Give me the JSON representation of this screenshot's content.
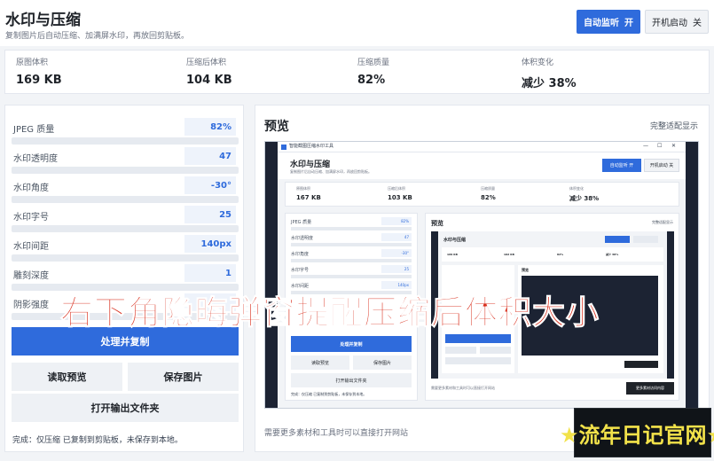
{
  "header": {
    "title": "水印与压缩",
    "subtitle": "复制图片后自动压缩、加满屏水印，再放回剪贴板。",
    "monitor_label": "自动监听",
    "monitor_state": "开",
    "startup_label": "开机启动",
    "startup_state": "关"
  },
  "stats": [
    {
      "label": "原图体积",
      "value": "169 KB"
    },
    {
      "label": "压缩后体积",
      "value": "104 KB"
    },
    {
      "label": "压缩质量",
      "value": "82%"
    },
    {
      "label": "体积变化",
      "value": "减少 38%"
    }
  ],
  "params": [
    {
      "label": "JPEG 质量",
      "value": "82%"
    },
    {
      "label": "水印透明度",
      "value": "47"
    },
    {
      "label": "水印角度",
      "value": "-30°"
    },
    {
      "label": "水印字号",
      "value": "25"
    },
    {
      "label": "水印间距",
      "value": "140px"
    },
    {
      "label": "雕刻深度",
      "value": "1"
    },
    {
      "label": "阴影强度",
      "value": ""
    }
  ],
  "actions": {
    "process": "处理并复制",
    "read_preview": "读取预览",
    "save_image": "保存图片",
    "open_folder": "打开输出文件夹"
  },
  "status": "完成：仅压缩 已复制到剪贴板，未保存到本地。",
  "preview": {
    "title": "预览",
    "fit_link": "完整适配显示",
    "hint": "需要更多素材和工具时可以直接打开网站",
    "window_title": "智能截图压缩水印工具",
    "inner": {
      "title": "水印与压缩",
      "subtitle": "复制图片后自动压缩、加满屏水印，再放回剪贴板。",
      "monitor": "自动监听  开",
      "startup": "开机启动  关",
      "stats": [
        {
          "label": "原图体积",
          "value": "167 KB"
        },
        {
          "label": "压缩后体积",
          "value": "103 KB"
        },
        {
          "label": "压缩质量",
          "value": "82%"
        },
        {
          "label": "体积变化",
          "value": "减少 38%"
        }
      ],
      "params": [
        {
          "label": "JPEG 质量",
          "value": "82%"
        },
        {
          "label": "水印透明度",
          "value": "47"
        },
        {
          "label": "水印角度",
          "value": "-30°"
        },
        {
          "label": "水印字号",
          "value": "25"
        },
        {
          "label": "水印间距",
          "value": "140px"
        }
      ],
      "process": "处理并复制",
      "read_preview": "读取预览",
      "save_image": "保存图片",
      "open_folder": "打开输出文件夹",
      "status": "完成：仅压缩 已复制到剪贴板，未保存到本地。",
      "preview_title": "预览",
      "fit_link": "完整适配显示",
      "hint": "需要更多素材和工具时可以直接打开网站",
      "visit": "更多素材访问内容",
      "nested_stats": [
        {
          "label": "原图体积",
          "value": "169 KB"
        },
        {
          "label": "压缩后体积",
          "value": "102 KB"
        },
        {
          "label": "压缩质量",
          "value": "82%"
        },
        {
          "label": "体积变化",
          "value": "减少 38%"
        }
      ],
      "nested_title": "水印与压缩",
      "nested_preview": "预览"
    }
  },
  "overlay_text": "右下角隐晦弹窗提醒压缩后体积大小",
  "watermark_text": "★流年日记官网★",
  "colors": {
    "accent": "#2f6bdc",
    "overlay": "#d9301e",
    "watermark": "#f2e24a"
  }
}
